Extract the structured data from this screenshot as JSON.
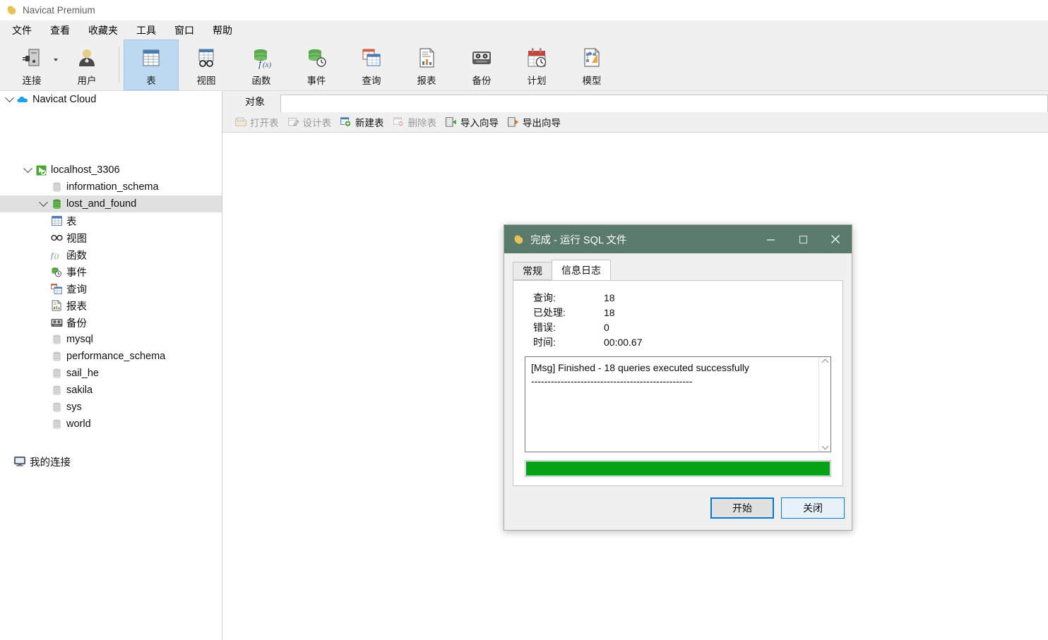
{
  "app": {
    "title": "Navicat Premium",
    "icon": "navicat-logo-icon"
  },
  "menubar": {
    "items": [
      {
        "label": "文件"
      },
      {
        "label": "查看"
      },
      {
        "label": "收藏夹"
      },
      {
        "label": "工具"
      },
      {
        "label": "窗口"
      },
      {
        "label": "帮助"
      }
    ]
  },
  "toolbar": {
    "buttons": [
      {
        "label": "连接",
        "icon": "connection-icon",
        "selected": false,
        "has_dropdown": true
      },
      {
        "label": "用户",
        "icon": "user-icon",
        "selected": false,
        "has_dropdown": false
      },
      {
        "label": "表",
        "icon": "table-icon",
        "selected": true,
        "has_dropdown": false
      },
      {
        "label": "视图",
        "icon": "view-icon",
        "selected": false,
        "has_dropdown": false
      },
      {
        "label": "函数",
        "icon": "function-icon",
        "selected": false,
        "has_dropdown": false
      },
      {
        "label": "事件",
        "icon": "event-icon",
        "selected": false,
        "has_dropdown": false
      },
      {
        "label": "查询",
        "icon": "query-icon",
        "selected": false,
        "has_dropdown": false
      },
      {
        "label": "报表",
        "icon": "report-icon",
        "selected": false,
        "has_dropdown": false
      },
      {
        "label": "备份",
        "icon": "backup-icon",
        "selected": false,
        "has_dropdown": false
      },
      {
        "label": "计划",
        "icon": "schedule-icon",
        "selected": false,
        "has_dropdown": false
      },
      {
        "label": "模型",
        "icon": "model-icon",
        "selected": false,
        "has_dropdown": false
      }
    ]
  },
  "sidebar": {
    "items": [
      {
        "label": "Navicat Cloud",
        "icon": "cloud-icon",
        "indent": 0,
        "twisty": "expanded",
        "selected": false,
        "spacer_after": 76
      },
      {
        "label": "localhost_3306",
        "icon": "connection-ok-icon",
        "indent": 1,
        "twisty": "expanded",
        "selected": false
      },
      {
        "label": "information_schema",
        "icon": "database-gray-icon",
        "indent": 2,
        "twisty": "none",
        "selected": false
      },
      {
        "label": "lost_and_found",
        "icon": "database-green-icon",
        "indent": 2,
        "twisty": "expanded",
        "selected": true
      },
      {
        "label": "表",
        "icon": "table-icon",
        "indent": 3,
        "twisty": "none",
        "selected": false
      },
      {
        "label": "视图",
        "icon": "view-icon",
        "indent": 3,
        "twisty": "none",
        "selected": false
      },
      {
        "label": "函数",
        "icon": "function-icon",
        "indent": 3,
        "twisty": "none",
        "selected": false
      },
      {
        "label": "事件",
        "icon": "event-icon",
        "indent": 3,
        "twisty": "none",
        "selected": false
      },
      {
        "label": "查询",
        "icon": "query-icon",
        "indent": 3,
        "twisty": "none",
        "selected": false
      },
      {
        "label": "报表",
        "icon": "report-icon",
        "indent": 3,
        "twisty": "none",
        "selected": false
      },
      {
        "label": "备份",
        "icon": "backup-icon",
        "indent": 3,
        "twisty": "none",
        "selected": false
      },
      {
        "label": "mysql",
        "icon": "database-gray-icon",
        "indent": 2,
        "twisty": "none",
        "selected": false
      },
      {
        "label": "performance_schema",
        "icon": "database-gray-icon",
        "indent": 2,
        "twisty": "none",
        "selected": false
      },
      {
        "label": "sail_he",
        "icon": "database-gray-icon",
        "indent": 2,
        "twisty": "none",
        "selected": false
      },
      {
        "label": "sakila",
        "icon": "database-gray-icon",
        "indent": 2,
        "twisty": "none",
        "selected": false
      },
      {
        "label": "sys",
        "icon": "database-gray-icon",
        "indent": 2,
        "twisty": "none",
        "selected": false
      },
      {
        "label": "world",
        "icon": "database-gray-icon",
        "indent": 2,
        "twisty": "none",
        "selected": false
      },
      {
        "label": "我的连接",
        "icon": "monitor-icon",
        "indent": 0,
        "twisty": "none",
        "selected": false,
        "spacer_before": 29
      }
    ]
  },
  "object_pane": {
    "tab_label": "对象",
    "actions": [
      {
        "label": "打开表",
        "icon": "open-table-icon",
        "disabled": true
      },
      {
        "label": "设计表",
        "icon": "design-table-icon",
        "disabled": true
      },
      {
        "label": "新建表",
        "icon": "new-table-icon",
        "disabled": false
      },
      {
        "label": "删除表",
        "icon": "delete-table-icon",
        "disabled": true
      },
      {
        "label": "导入向导",
        "icon": "import-wizard-icon",
        "disabled": false
      },
      {
        "label": "导出向导",
        "icon": "export-wizard-icon",
        "disabled": false
      }
    ]
  },
  "dialog": {
    "title": "完成 - 运行 SQL 文件",
    "icon": "navicat-logo-icon",
    "window_controls": {
      "minimize": "minimize-icon",
      "maximize": "maximize-icon",
      "close": "close-icon"
    },
    "tabs": [
      {
        "label": "常规",
        "active": false
      },
      {
        "label": "信息日志",
        "active": true
      }
    ],
    "stats": [
      {
        "key": "查询:",
        "value": "18"
      },
      {
        "key": "已处理:",
        "value": "18"
      },
      {
        "key": "错误:",
        "value": "0"
      },
      {
        "key": "时间:",
        "value": "00:00.67"
      }
    ],
    "log": "[Msg] Finished - 18 queries executed successfully\n-------------------------------------------------",
    "progress": {
      "percent": 100,
      "color": "#06a119"
    },
    "buttons": [
      {
        "label": "开始",
        "style": "primary"
      },
      {
        "label": "关闭",
        "style": "secondary"
      }
    ]
  },
  "colors": {
    "dialog_titlebar": "#5a7a6b",
    "toolbar_selected": "#bcd9f2",
    "tree_selected": "#e0e0e0",
    "progress_green": "#06a119",
    "focus_blue": "#0078d7"
  }
}
